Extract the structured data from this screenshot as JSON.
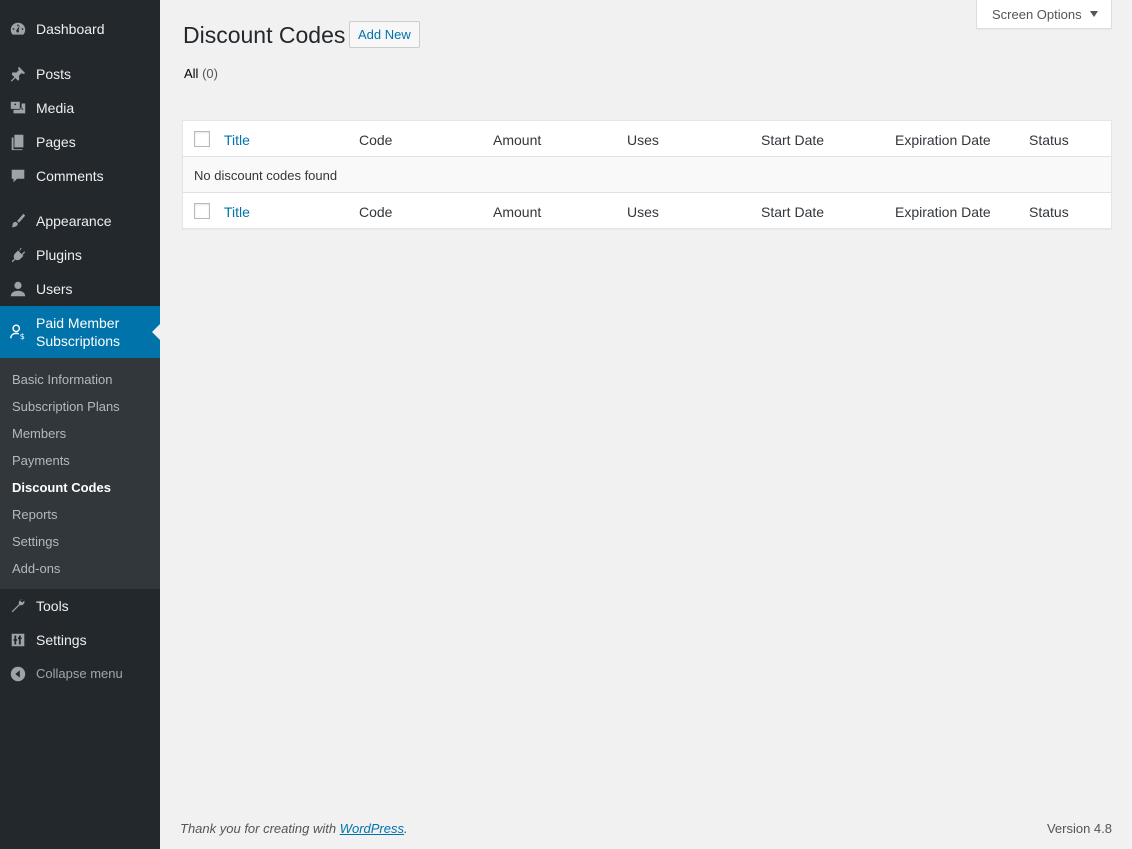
{
  "sidebar": {
    "items": [
      {
        "label": "Dashboard",
        "icon": "dashboard-icon"
      },
      {
        "label": "Posts",
        "icon": "pin-icon"
      },
      {
        "label": "Media",
        "icon": "media-icon"
      },
      {
        "label": "Pages",
        "icon": "pages-icon"
      },
      {
        "label": "Comments",
        "icon": "comment-icon"
      },
      {
        "label": "Appearance",
        "icon": "brush-icon"
      },
      {
        "label": "Plugins",
        "icon": "plug-icon"
      },
      {
        "label": "Users",
        "icon": "user-icon"
      },
      {
        "label": "Paid Member Subscriptions",
        "icon": "member-dollar-icon"
      },
      {
        "label": "Tools",
        "icon": "wrench-icon"
      },
      {
        "label": "Settings",
        "icon": "sliders-icon"
      }
    ],
    "submenu": [
      "Basic Information",
      "Subscription Plans",
      "Members",
      "Payments",
      "Discount Codes",
      "Reports",
      "Settings",
      "Add-ons"
    ],
    "active_submenu": "Discount Codes",
    "collapse_label": "Collapse menu"
  },
  "header": {
    "screen_options": "Screen Options",
    "title": "Discount Codes",
    "add_new": "Add New"
  },
  "filters": {
    "all_label": "All",
    "all_count": "(0)"
  },
  "table": {
    "columns": [
      "Title",
      "Code",
      "Amount",
      "Uses",
      "Start Date",
      "Expiration Date",
      "Status"
    ],
    "empty_message": "No discount codes found"
  },
  "footer": {
    "thanks_prefix": "Thank you for creating with ",
    "wordpress_link": "WordPress",
    "thanks_suffix": ".",
    "version": "Version 4.8"
  },
  "colors": {
    "menu_bg": "#23282d",
    "submenu_bg": "#32373c",
    "accent": "#0073aa",
    "page_bg": "#f1f1f1"
  }
}
